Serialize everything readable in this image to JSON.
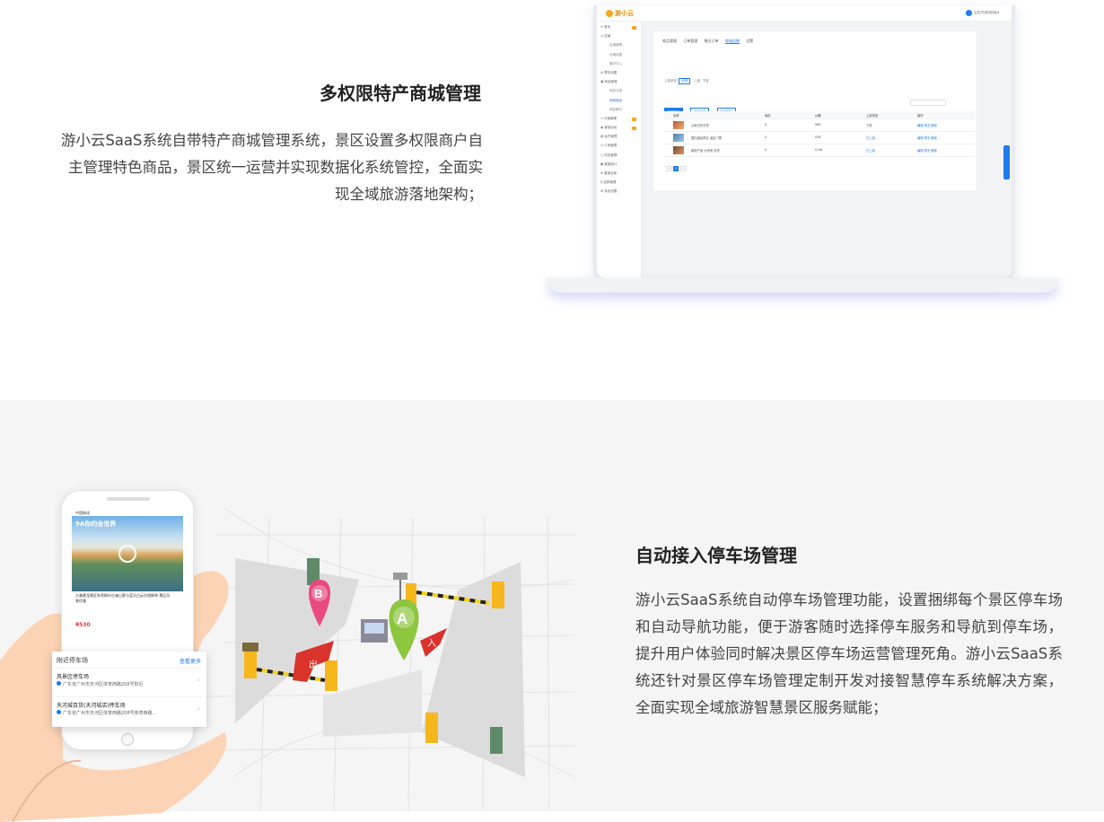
{
  "section1": {
    "title": "多权限特产商城管理",
    "description": "游小云SaaS系统自带特产商城管理系统，景区设置多权限商户自主管理特色商品，景区统一运营并实现数据化系统管控，全面实现全域旅游落地架构；",
    "laptop_screenshot": {
      "logo": "游小云",
      "user": "13570990944",
      "tabs": [
        "商品管理",
        "订单管理",
        "售后订单",
        "商城店铺",
        "设置"
      ],
      "active_tab": "商城店铺",
      "filter_label": "上架状态",
      "filter_options": [
        "全部",
        "上架",
        "下架"
      ],
      "action_buttons": [
        "批量商品",
        "批量下架",
        "批量删除"
      ],
      "table_headers": [
        "",
        "名称",
        "库存",
        "价格",
        "上架状态",
        "操作"
      ],
      "rows": [
        {
          "name": "云南白药牙膏",
          "stock": "0",
          "price": "¥86",
          "status": "下架",
          "ops": "编辑 预览 删除"
        },
        {
          "name": "国内酒店预定 景区门票",
          "stock": "0",
          "price": "¥36",
          "status": "已上架",
          "ops": "编辑 预览 删除"
        },
        {
          "name": "客房产品 大床房 含早",
          "stock": "0",
          "price": "¥196",
          "status": "已上架",
          "ops": "编辑 预览 删除"
        }
      ],
      "pager_current": "1"
    }
  },
  "section2": {
    "title": "自动接入停车场管理",
    "description": "游小云SaaS系统自动停车场管理功能，设置捆绑每个景区停车场和自动导航功能，便于游客随时选择停车服务和导航到停车场，提升用户体验同时解决景区停车场运营管理死角。游小云SaaS系统还针对景区停车场管理定制开发对接智慧停车系统解决方案，全面实现全域旅游智慧景区服务赋能；",
    "phone": {
      "status_bar": "中国移动",
      "photo_title": "9A你的全世界",
      "caption": "大美黄龙景区秋季枫叶红遍山野与蓝天白云交相辉映 景区风景优美",
      "price": "¥530",
      "popup": {
        "heading": "附近停车场",
        "more": "查看更多",
        "items": [
          {
            "name": "风景区停车场",
            "address": "广东省广州市天河区体育西路208号附近"
          },
          {
            "name": "天河城百货(天河城店)停车场",
            "address": "广东省广州市天河区体育西路208号体育西路..."
          }
        ]
      }
    },
    "map_markers": [
      "B",
      "A",
      "入",
      "出"
    ]
  },
  "colors": {
    "accent": "#1e7be8",
    "marker_b": "#e84a7f",
    "marker_a": "#8dc63f",
    "barrier": "#f5b71c",
    "arrow_red": "#d9332b"
  }
}
